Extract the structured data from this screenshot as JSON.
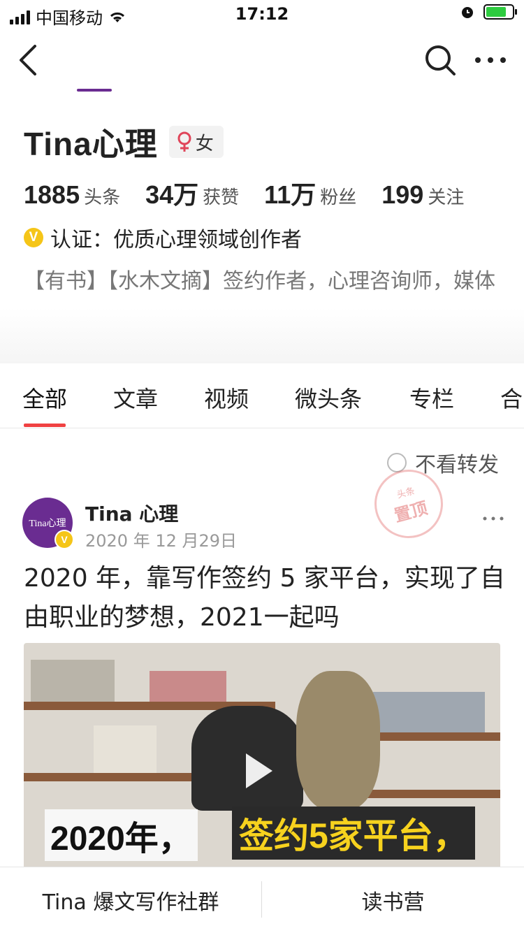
{
  "status": {
    "carrier": "中国移动",
    "time": "17:12"
  },
  "profile": {
    "name": "Tina心理",
    "gender": "女",
    "stats": [
      {
        "num": "1885",
        "label": "头条"
      },
      {
        "num": "34万",
        "label": "获赞"
      },
      {
        "num": "11万",
        "label": "粉丝"
      },
      {
        "num": "199",
        "label": "关注"
      }
    ],
    "verify": "认证：优质心理领域创作者",
    "bio": "【有书】【水木文摘】签约作者，心理咨询师，媒体记者，浙大硕士"
  },
  "tabs": [
    "全部",
    "文章",
    "视频",
    "微头条",
    "专栏",
    "合"
  ],
  "filter": {
    "label": "不看转发"
  },
  "stamp": {
    "top": "头条",
    "main": "置顶"
  },
  "post": {
    "avatar_text": "Tina心理",
    "author": "Tina 心理",
    "date": "2020 年 12 月29日",
    "title": "2020 年，靠写作签约 5 家平台，实现了自由职业的梦想，2021一起吗",
    "caption_left": "2020年，",
    "caption_right": "签约5家平台，"
  },
  "bottom": {
    "left": "Tina 爆文写作社群",
    "right": "读书营"
  },
  "colors": {
    "accent": "#f04142",
    "verify": "#f5c518",
    "avatar": "#6a2c91"
  }
}
